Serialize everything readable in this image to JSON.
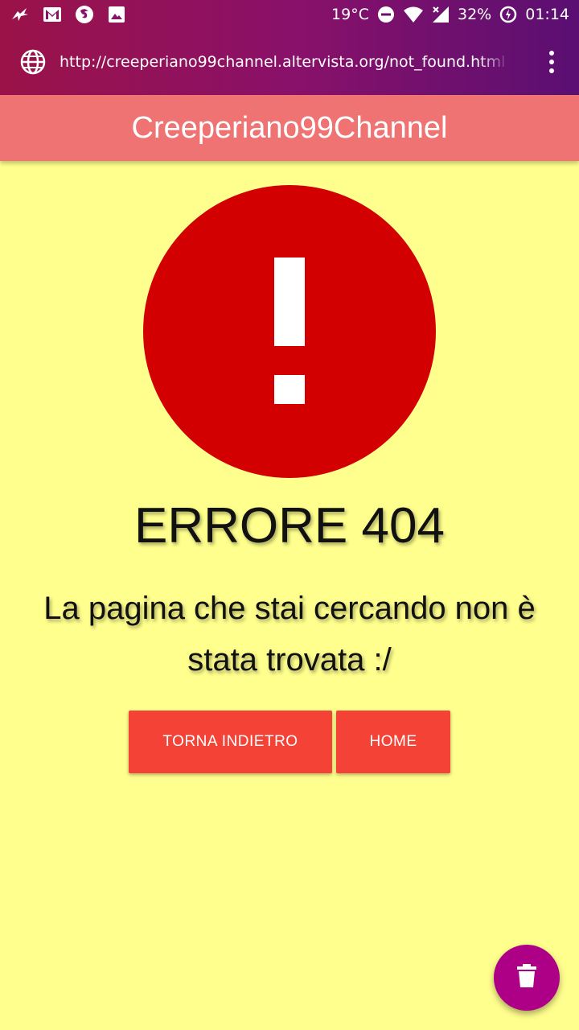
{
  "status_bar": {
    "temperature": "19°C",
    "battery": "32%",
    "time": "01:14",
    "icons": [
      "app-notification-icon",
      "gmail-icon",
      "firefox-icon",
      "image-icon",
      "dnd-icon",
      "wifi-icon",
      "signal-icon",
      "battery-saver-icon"
    ]
  },
  "browser": {
    "url": "http://creeperiano99channel.altervista.org/not_found.html",
    "menu_icon": "more-vert-icon",
    "site_icon": "globe-icon"
  },
  "app_bar": {
    "title": "Creeperiano99Channel"
  },
  "error": {
    "icon": "alert-icon",
    "title": "ERRORE 404",
    "message": "La pagina che stai cercando non è stata trovata :/"
  },
  "buttons": {
    "back_label": "TORNA INDIETRO",
    "home_label": "HOME"
  },
  "fab": {
    "icon": "trash-icon"
  },
  "colors": {
    "page_background": "#ffff8d",
    "app_bar": "#f07373",
    "alert_circle": "#d20000",
    "button": "#f44336",
    "fab": "#ad0087"
  }
}
